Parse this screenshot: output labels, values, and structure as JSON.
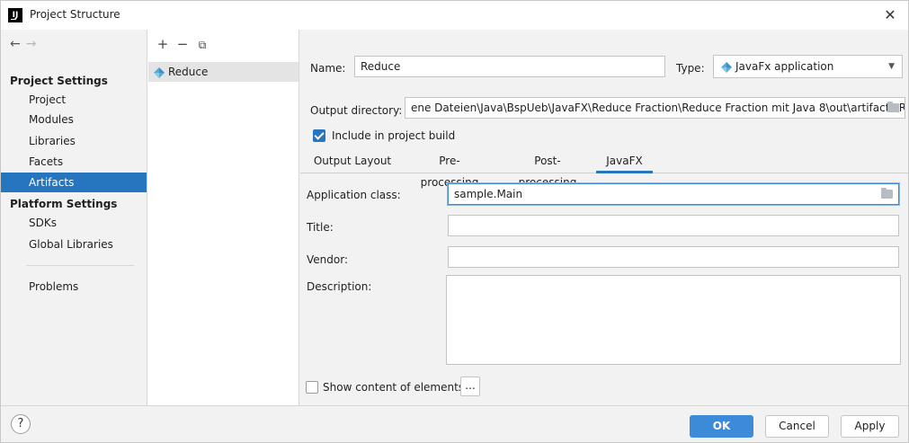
{
  "window": {
    "title": "Project Structure",
    "logo_text": "IJ",
    "close_glyph": "✕"
  },
  "nav": {
    "back_glyph": "←",
    "forward_glyph": "→",
    "project_settings_label": "Project Settings",
    "project_items": [
      "Project",
      "Modules",
      "Libraries",
      "Facets",
      "Artifacts"
    ],
    "selected_item": "Artifacts",
    "platform_settings_label": "Platform Settings",
    "platform_items": [
      "SDKs",
      "Global Libraries"
    ],
    "problems_label": "Problems"
  },
  "artifacts": {
    "add_glyph": "+",
    "remove_glyph": "−",
    "copy_glyph": "⧉",
    "items": [
      {
        "name": "Reduce",
        "icon": "javafx-gem-icon"
      }
    ]
  },
  "form": {
    "name_label": "Name:",
    "name_value": "Reduce",
    "type_label": "Type:",
    "type_value": "JavaFx application",
    "output_dir_label": "Output directory:",
    "output_dir_value": "ene Dateien\\Java\\BspUeb\\JavaFX\\Reduce Fraction\\Reduce Fraction mit Java 8\\out\\artifacts\\Reduce",
    "include_build_label": "Include in project build",
    "include_build_checked": true
  },
  "tabs": {
    "items": [
      "Output Layout",
      "Pre-processing",
      "Post-processing",
      "JavaFX"
    ],
    "active": "JavaFX"
  },
  "javafx": {
    "app_class_label": "Application class:",
    "app_class_value": "sample.Main",
    "title_label": "Title:",
    "title_value": "",
    "vendor_label": "Vendor:",
    "vendor_value": "",
    "description_label": "Description:",
    "description_value": "",
    "show_content_label": "Show content of elements",
    "show_content_checked": false,
    "ellipsis_label": "..."
  },
  "footer": {
    "help_glyph": "?",
    "ok_label": "OK",
    "cancel_label": "Cancel",
    "apply_label": "Apply"
  },
  "colors": {
    "accent": "#2675bf",
    "primary_button": "#3d8ad8",
    "panel_bg": "#f2f2f2"
  }
}
